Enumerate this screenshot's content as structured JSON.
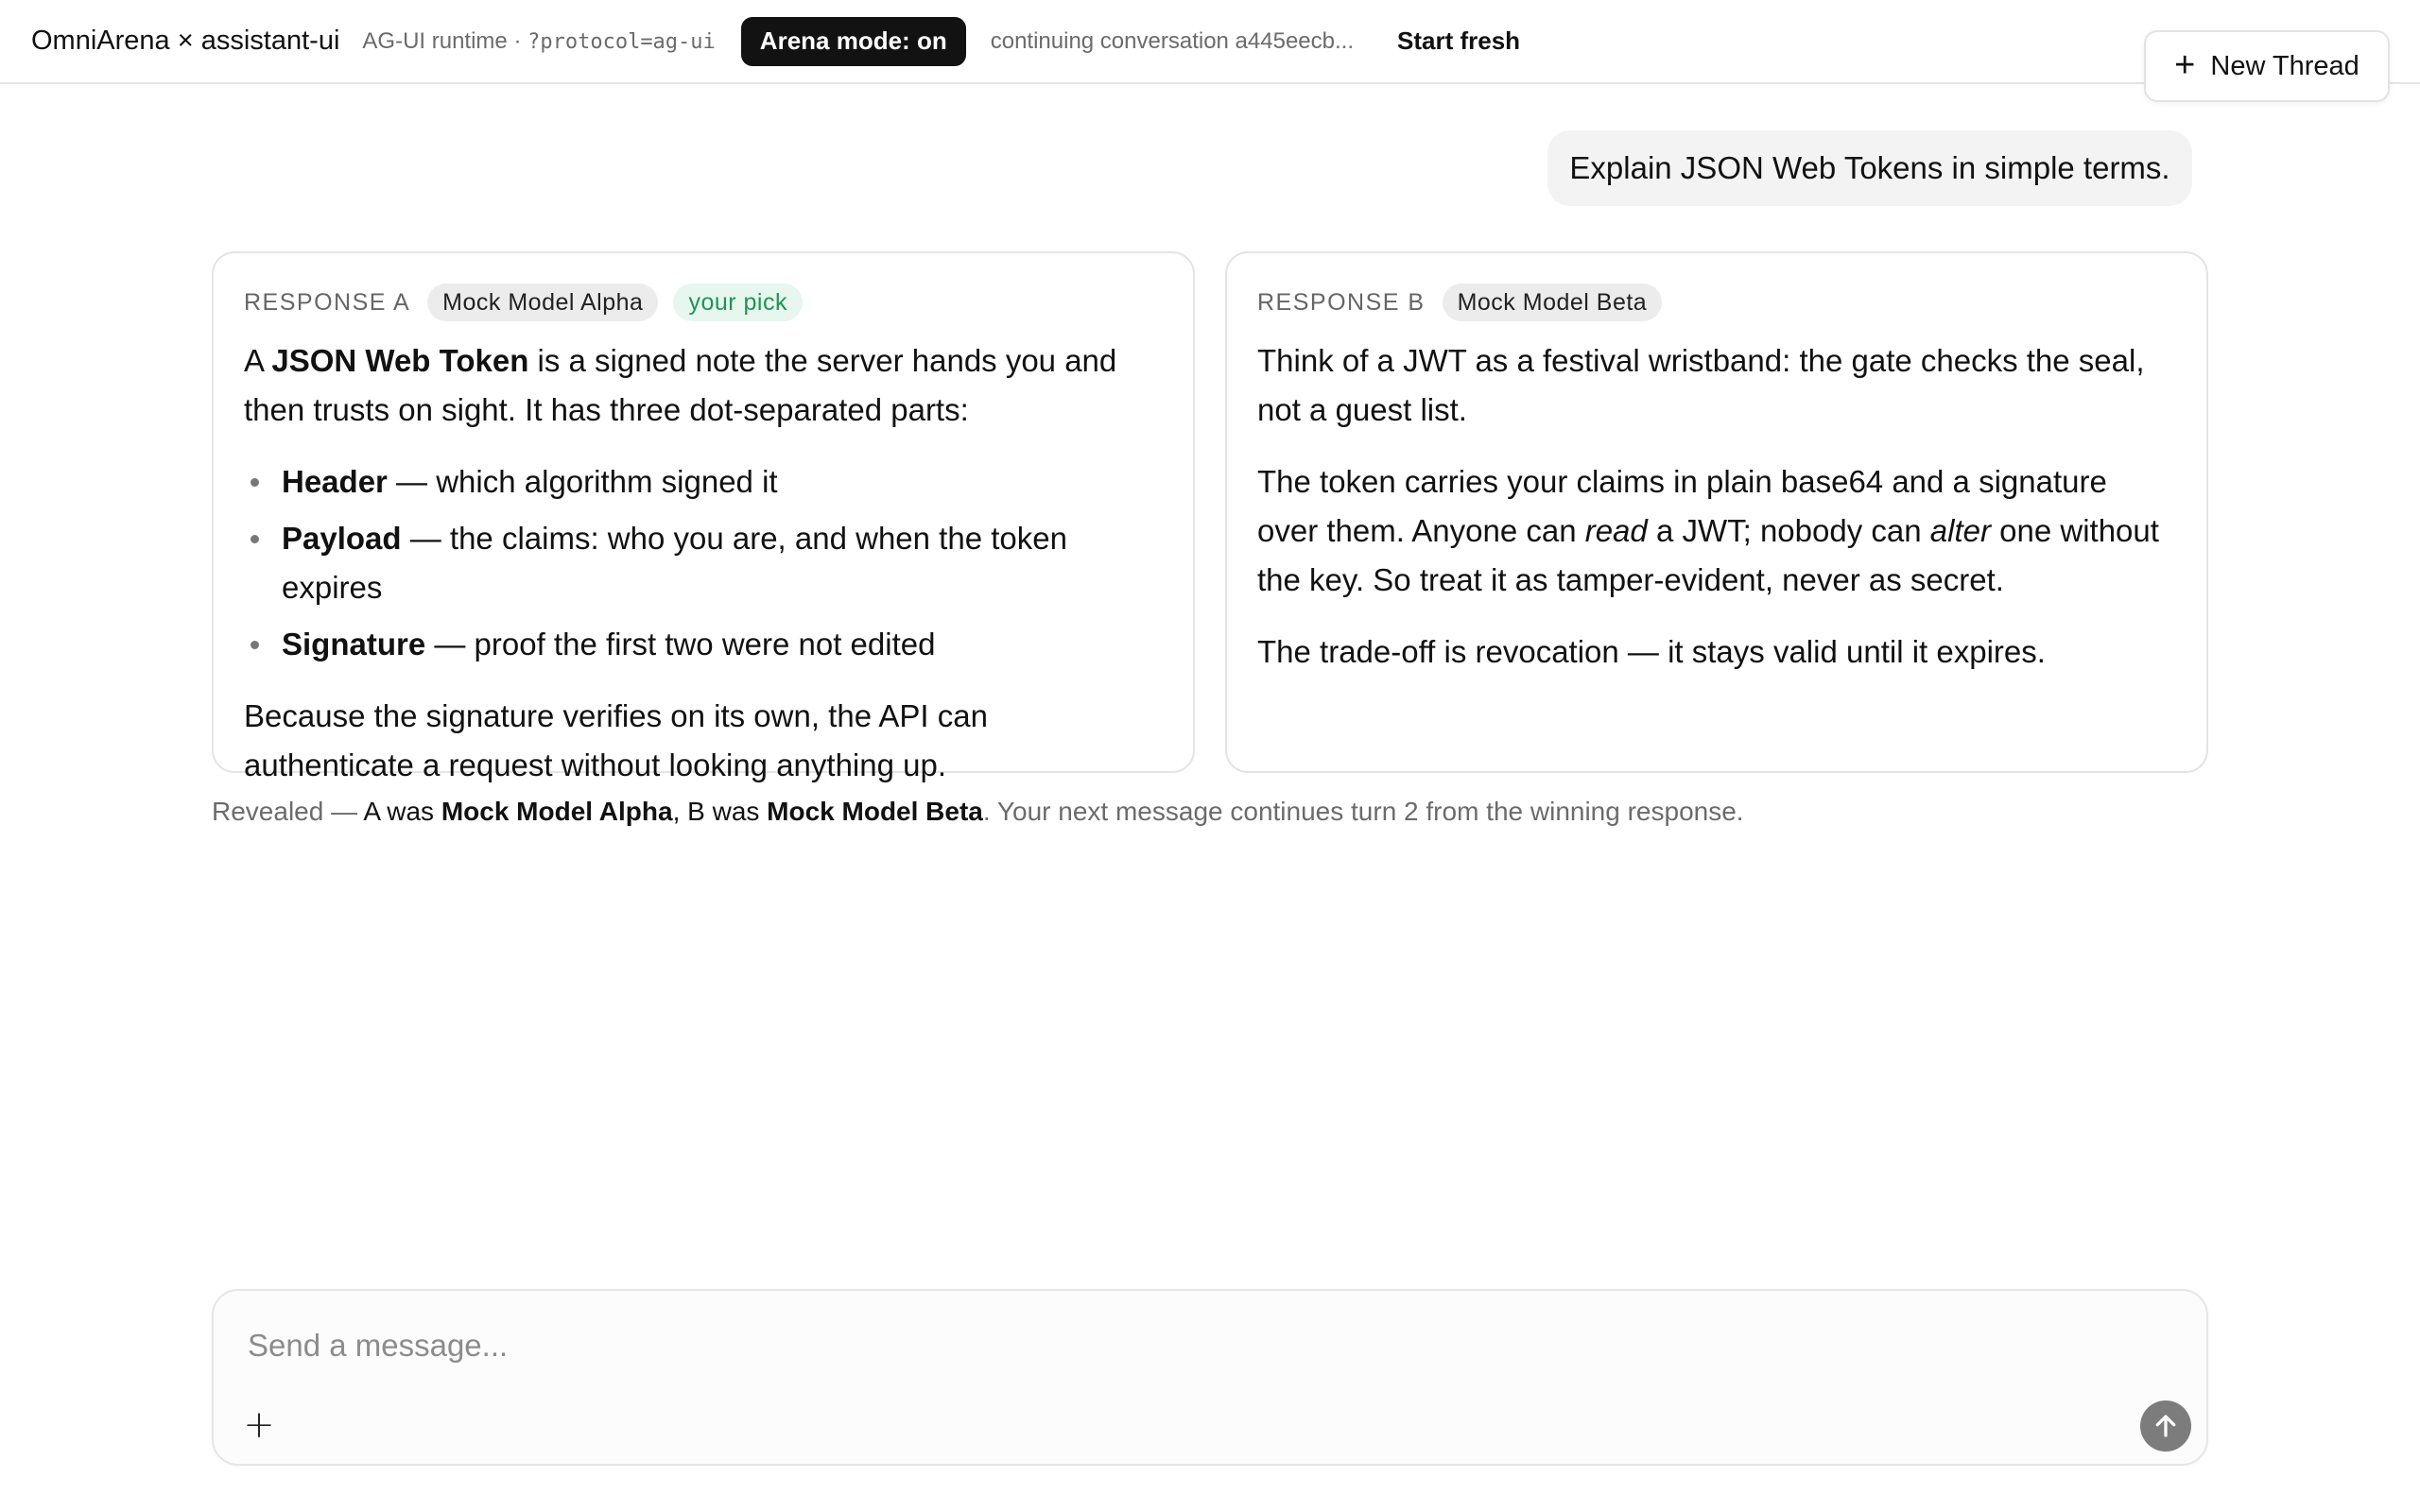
{
  "header": {
    "brand": "OmniArena × assistant-ui",
    "runtime_prefix": "AG-UI runtime · ",
    "runtime_param": "?protocol=ag-ui",
    "arena_mode": "Arena mode: on",
    "continuing": "continuing conversation a445eecb...",
    "start_fresh": "Start fresh",
    "new_thread": "New Thread"
  },
  "user_message": "Explain JSON Web Tokens in simple terms.",
  "responses": [
    {
      "label": "RESPONSE A",
      "model": "Mock Model Alpha",
      "badge": "your pick",
      "p1_pre": "A ",
      "p1_bold": "JSON Web Token",
      "p1_post": " is a signed note the server hands you and then trusts on sight. It has three dot-separated parts:",
      "bullets": [
        {
          "bold": "Header",
          "text": " — which algorithm signed it"
        },
        {
          "bold": "Payload",
          "text": " — the claims: who you are, and when the token expires"
        },
        {
          "bold": "Signature",
          "text": " — proof the first two were not edited"
        }
      ],
      "p2": "Because the signature verifies on its own, the API can authenticate a request without looking anything up."
    },
    {
      "label": "RESPONSE B",
      "model": "Mock Model Beta",
      "p1": "Think of a JWT as a festival wristband: the gate checks the seal, not a guest list.",
      "p2_a": "The token carries your claims in plain base64 and a signature over them. Anyone can ",
      "p2_i1": "read",
      "p2_b": " a JWT; nobody can ",
      "p2_i2": "alter",
      "p2_c": " one without the key. So treat it as tamper-evident, never as secret.",
      "p3": "The trade-off is revocation — it stays valid until it expires."
    }
  ],
  "revealed": {
    "prefix": "Revealed — ",
    "a_was": "A was ",
    "model_a": "Mock Model Alpha",
    "b_was": ", B was ",
    "model_b": "Mock Model Beta",
    "suffix": ". Your next message continues turn 2 from the winning response."
  },
  "composer": {
    "placeholder": "Send a message..."
  },
  "icons": {
    "new_thread": "plus-icon",
    "attach": "plus-icon",
    "send": "arrow-up-icon"
  },
  "colors": {
    "arena_pill_bg": "#121212",
    "pick_badge_text": "#1e9455",
    "pick_badge_bg": "#e7f6ee",
    "send_button": "#7c7c7c"
  }
}
